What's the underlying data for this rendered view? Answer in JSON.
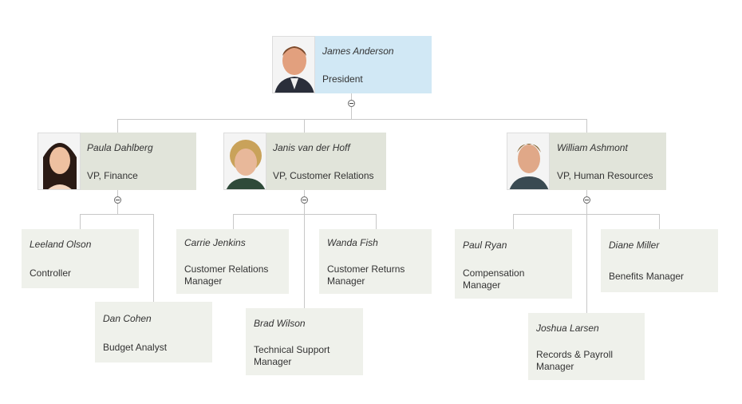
{
  "colors": {
    "root": "#d1e8f5",
    "vp": "#e1e4da",
    "leaf": "#eff1eb",
    "connector": "#c8c8c8"
  },
  "root": {
    "name": "James Anderson",
    "title": "President"
  },
  "vps": [
    {
      "name": "Paula Dahlberg",
      "title": "VP, Finance"
    },
    {
      "name": "Janis van der Hoff",
      "title": "VP, Customer Relations"
    },
    {
      "name": "William Ashmont",
      "title": "VP, Human Resources"
    }
  ],
  "staff": [
    {
      "name": "Leeland Olson",
      "title": "Controller"
    },
    {
      "name": "Dan Cohen",
      "title": "Budget Analyst"
    },
    {
      "name": "Carrie Jenkins",
      "title": "Customer Relations Manager"
    },
    {
      "name": "Wanda Fish",
      "title": "Customer Returns Manager"
    },
    {
      "name": "Brad Wilson",
      "title": "Technical Support Manager"
    },
    {
      "name": "Paul Ryan",
      "title": "Compensation Manager"
    },
    {
      "name": "Diane Miller",
      "title": "Benefits Manager"
    },
    {
      "name": "Joshua Larsen",
      "title": "Records & Payroll Manager"
    }
  ]
}
